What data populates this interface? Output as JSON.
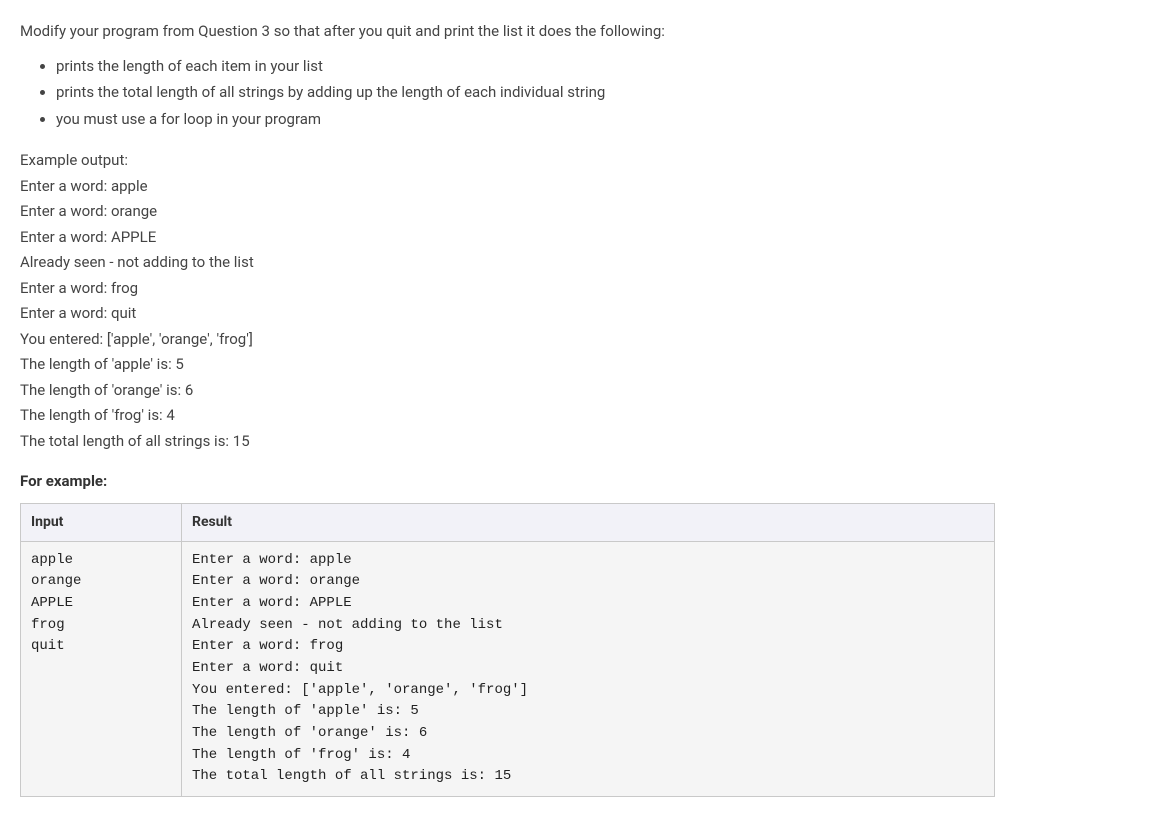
{
  "intro": "Modify your program from Question 3 so that after you quit and print the list it does the following:",
  "bullets": [
    "prints the length of each item in your list",
    "prints the total length of all strings by adding up the length of each individual string",
    "you must use a for loop in your program"
  ],
  "example_label": "Example output:",
  "example_lines": [
    "Enter a word: apple",
    "Enter a word: orange",
    "Enter a word: APPLE",
    "Already seen - not adding to the list",
    "Enter a word: frog",
    "Enter a word: quit",
    "You entered: ['apple', 'orange', 'frog']",
    "The length of 'apple' is: 5",
    "The length of 'orange' is: 6",
    "The length of 'frog' is: 4",
    "The total length of all strings is: 15"
  ],
  "for_example_label": "For example:",
  "table": {
    "headers": [
      "Input",
      "Result"
    ],
    "rows": [
      {
        "input": "apple\norange\nAPPLE\nfrog\nquit",
        "result": "Enter a word: apple\nEnter a word: orange\nEnter a word: APPLE\nAlready seen - not adding to the list\nEnter a word: frog\nEnter a word: quit\nYou entered: ['apple', 'orange', 'frog']\nThe length of 'apple' is: 5\nThe length of 'orange' is: 6\nThe length of 'frog' is: 4\nThe total length of all strings is: 15"
      }
    ]
  }
}
